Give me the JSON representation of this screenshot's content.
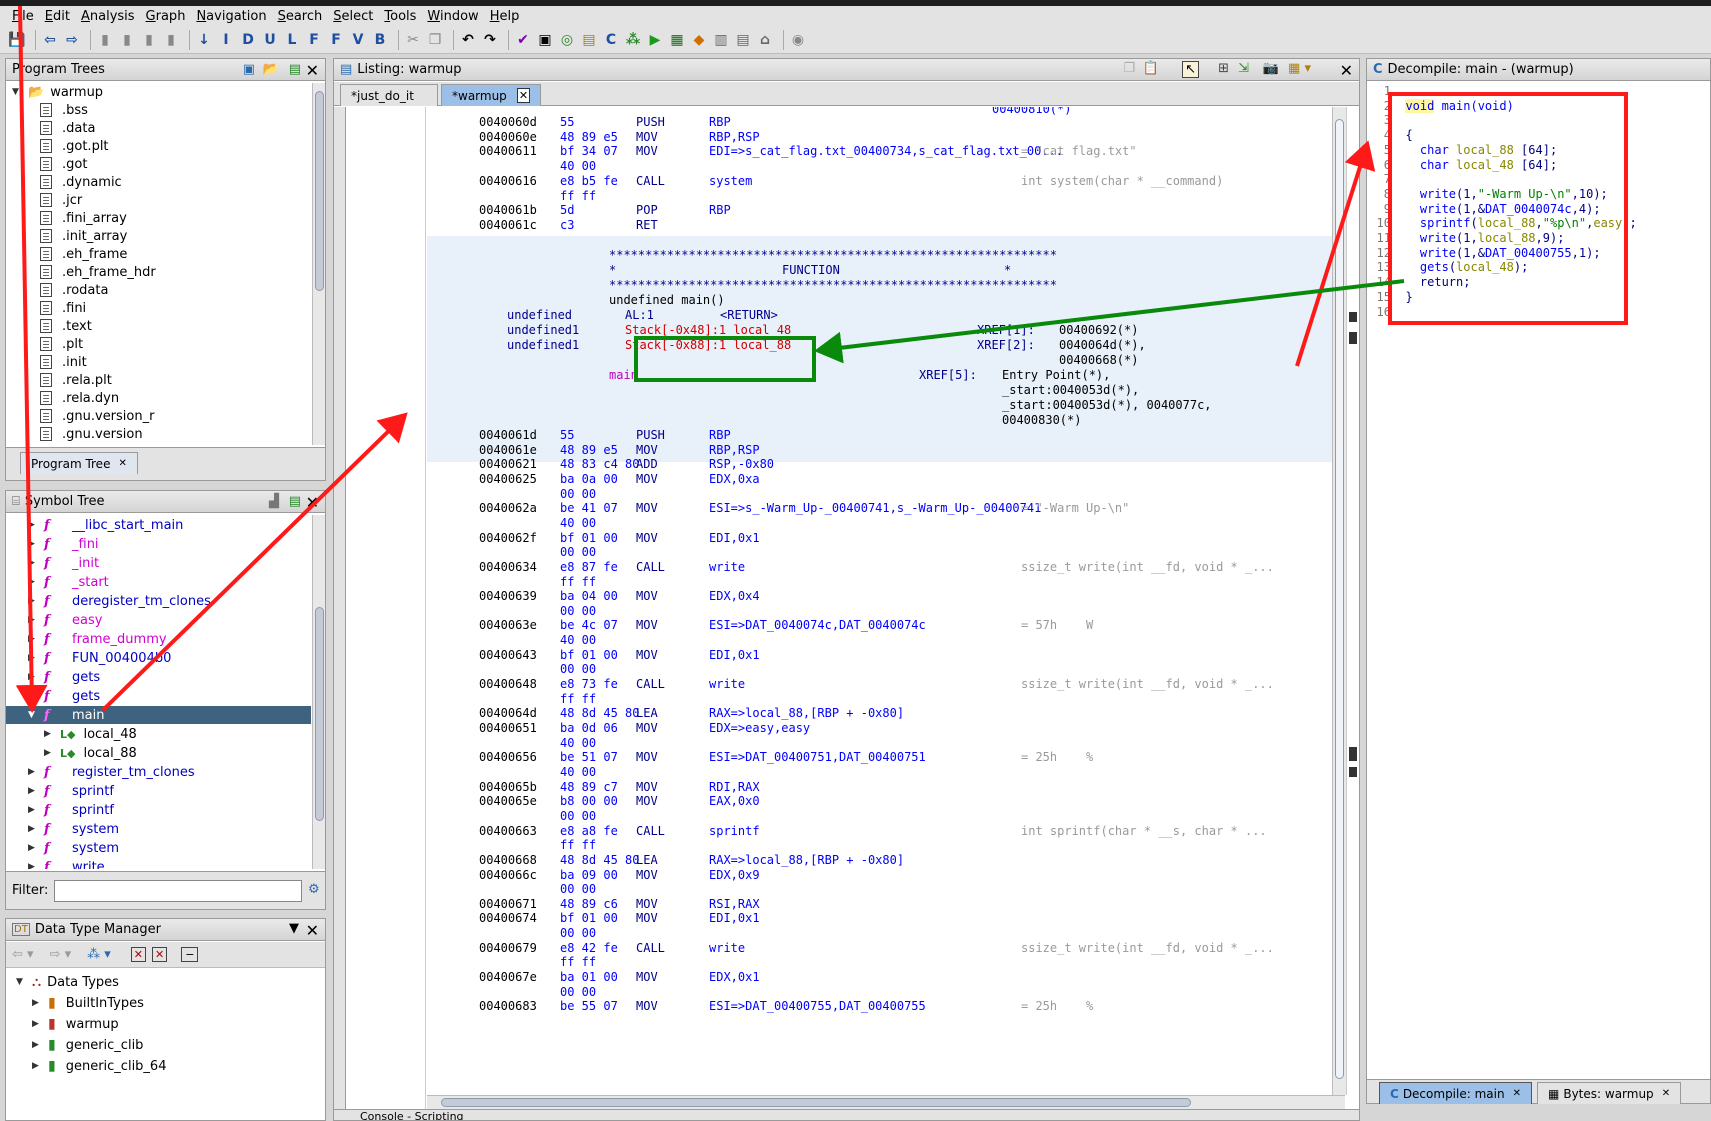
{
  "menu": [
    "File",
    "Edit",
    "Analysis",
    "Graph",
    "Navigation",
    "Search",
    "Select",
    "Tools",
    "Window",
    "Help"
  ],
  "program_trees": {
    "title": "Program Trees",
    "root": "warmup",
    "sections": [
      ".bss",
      ".data",
      ".got.plt",
      ".got",
      ".dynamic",
      ".jcr",
      ".fini_array",
      ".init_array",
      ".eh_frame",
      ".eh_frame_hdr",
      ".rodata",
      ".fini",
      ".text",
      ".plt",
      ".init",
      ".rela.plt",
      ".rela.dyn",
      ".gnu.version_r",
      ".gnu.version"
    ],
    "tab": "Program Tree"
  },
  "symbol_tree": {
    "title": "Symbol Tree",
    "items": [
      {
        "label": "__libc_start_main",
        "color": "blue"
      },
      {
        "label": "_fini",
        "color": "mag"
      },
      {
        "label": "_init",
        "color": "mag"
      },
      {
        "label": "_start",
        "color": "mag"
      },
      {
        "label": "deregister_tm_clones",
        "color": "blue"
      },
      {
        "label": "easy",
        "color": "mag"
      },
      {
        "label": "frame_dummy",
        "color": "mag"
      },
      {
        "label": "FUN_004004b0",
        "color": "blue"
      },
      {
        "label": "gets",
        "color": "blue"
      },
      {
        "label": "gets",
        "color": "blue"
      },
      {
        "label": "main",
        "color": "sel"
      },
      {
        "label": "local_48",
        "color": "child"
      },
      {
        "label": "local_88",
        "color": "child"
      },
      {
        "label": "register_tm_clones",
        "color": "blue"
      },
      {
        "label": "sprintf",
        "color": "blue"
      },
      {
        "label": "sprintf",
        "color": "blue"
      },
      {
        "label": "system",
        "color": "blue"
      },
      {
        "label": "system",
        "color": "blue"
      },
      {
        "label": "write",
        "color": "blue"
      }
    ],
    "filter_label": "Filter:",
    "filter_value": ""
  },
  "data_type_manager": {
    "title": "Data Type Manager",
    "root": "Data Types",
    "items": [
      "BuiltInTypes",
      "warmup",
      "generic_clib",
      "generic_clib_64"
    ]
  },
  "listing": {
    "title": "Listing:  warmup",
    "tabs": [
      "*just_do_it",
      "*warmup"
    ],
    "top_partial": "00400810(*)",
    "rows_pre": [
      {
        "a": "0040060d",
        "b": "55",
        "m": "PUSH",
        "o": "RBP",
        "c": ""
      },
      {
        "a": "0040060e",
        "b": "48 89 e5",
        "m": "MOV",
        "o": "RBP,RSP",
        "c": ""
      },
      {
        "a": "00400611",
        "b": "bf 34 07",
        "m": "MOV",
        "o": "EDI=>s_cat_flag.txt_00400734,s_cat_flag.txt_00...",
        "c": "= \"cat flag.txt\""
      },
      {
        "a": "",
        "b": "40 00",
        "m": "",
        "o": "",
        "c": ""
      },
      {
        "a": "00400616",
        "b": "e8 b5 fe",
        "m": "CALL",
        "o": "system",
        "c": "int system(char * __command)"
      },
      {
        "a": "",
        "b": "ff ff",
        "m": "",
        "o": "",
        "c": ""
      },
      {
        "a": "0040061b",
        "b": "5d",
        "m": "POP",
        "o": "RBP",
        "c": ""
      },
      {
        "a": "0040061c",
        "b": "c3",
        "m": "RET",
        "o": "",
        "c": ""
      }
    ],
    "func_header": {
      "stars": "**************************************************************",
      "label": "FUNCTION",
      "signature": "undefined main()",
      "ret_type": "undefined",
      "ret_reg": "AL:1",
      "ret_tag": "<RETURN>",
      "var1_type": "undefined1",
      "var1": "Stack[-0x48]:1 local_48",
      "var2_type": "undefined1",
      "var2": "Stack[-0x88]:1 local_88",
      "xref1_label": "XREF[1]:",
      "xref1": "00400692(*)",
      "xref2_label": "XREF[2]:",
      "xref2a": "0040064d(*),",
      "xref2b": "00400668(*)",
      "name": "main",
      "xref5_label": "XREF[5]:",
      "xref5": [
        "Entry Point(*),",
        "_start:0040053d(*),",
        "_start:0040053d(*), 0040077c,",
        "00400830(*)"
      ]
    },
    "rows_post": [
      {
        "a": "0040061d",
        "b": "55",
        "m": "PUSH",
        "o": "RBP",
        "c": ""
      },
      {
        "a": "0040061e",
        "b": "48 89 e5",
        "m": "MOV",
        "o": "RBP,RSP",
        "c": ""
      },
      {
        "a": "00400621",
        "b": "48 83 c4 80",
        "m": "ADD",
        "o": "RSP,-0x80",
        "c": ""
      },
      {
        "a": "00400625",
        "b": "ba 0a 00",
        "m": "MOV",
        "o": "EDX,0xa",
        "c": ""
      },
      {
        "a": "",
        "b": "00 00",
        "m": "",
        "o": "",
        "c": ""
      },
      {
        "a": "0040062a",
        "b": "be 41 07",
        "m": "MOV",
        "o": "ESI=>s_-Warm_Up-_00400741,s_-Warm_Up-_00400741",
        "c": "= \"-Warm Up-\\n\""
      },
      {
        "a": "",
        "b": "40 00",
        "m": "",
        "o": "",
        "c": ""
      },
      {
        "a": "0040062f",
        "b": "bf 01 00",
        "m": "MOV",
        "o": "EDI,0x1",
        "c": ""
      },
      {
        "a": "",
        "b": "00 00",
        "m": "",
        "o": "",
        "c": ""
      },
      {
        "a": "00400634",
        "b": "e8 87 fe",
        "m": "CALL",
        "o": "write",
        "c": "ssize_t write(int __fd, void * _..."
      },
      {
        "a": "",
        "b": "ff ff",
        "m": "",
        "o": "",
        "c": ""
      },
      {
        "a": "00400639",
        "b": "ba 04 00",
        "m": "MOV",
        "o": "EDX,0x4",
        "c": ""
      },
      {
        "a": "",
        "b": "00 00",
        "m": "",
        "o": "",
        "c": ""
      },
      {
        "a": "0040063e",
        "b": "be 4c 07",
        "m": "MOV",
        "o": "ESI=>DAT_0040074c,DAT_0040074c",
        "c": "= 57h    W"
      },
      {
        "a": "",
        "b": "40 00",
        "m": "",
        "o": "",
        "c": ""
      },
      {
        "a": "00400643",
        "b": "bf 01 00",
        "m": "MOV",
        "o": "EDI,0x1",
        "c": ""
      },
      {
        "a": "",
        "b": "00 00",
        "m": "",
        "o": "",
        "c": ""
      },
      {
        "a": "00400648",
        "b": "e8 73 fe",
        "m": "CALL",
        "o": "write",
        "c": "ssize_t write(int __fd, void * _..."
      },
      {
        "a": "",
        "b": "ff ff",
        "m": "",
        "o": "",
        "c": ""
      },
      {
        "a": "0040064d",
        "b": "48 8d 45 80",
        "m": "LEA",
        "o": "RAX=>local_88,[RBP + -0x80]",
        "c": ""
      },
      {
        "a": "00400651",
        "b": "ba 0d 06",
        "m": "MOV",
        "o": "EDX=>easy,easy",
        "c": ""
      },
      {
        "a": "",
        "b": "40 00",
        "m": "",
        "o": "",
        "c": ""
      },
      {
        "a": "00400656",
        "b": "be 51 07",
        "m": "MOV",
        "o": "ESI=>DAT_00400751,DAT_00400751",
        "c": "= 25h    %"
      },
      {
        "a": "",
        "b": "40 00",
        "m": "",
        "o": "",
        "c": ""
      },
      {
        "a": "0040065b",
        "b": "48 89 c7",
        "m": "MOV",
        "o": "RDI,RAX",
        "c": ""
      },
      {
        "a": "0040065e",
        "b": "b8 00 00",
        "m": "MOV",
        "o": "EAX,0x0",
        "c": ""
      },
      {
        "a": "",
        "b": "00 00",
        "m": "",
        "o": "",
        "c": ""
      },
      {
        "a": "00400663",
        "b": "e8 a8 fe",
        "m": "CALL",
        "o": "sprintf",
        "c": "int sprintf(char * __s, char * ..."
      },
      {
        "a": "",
        "b": "ff ff",
        "m": "",
        "o": "",
        "c": ""
      },
      {
        "a": "00400668",
        "b": "48 8d 45 80",
        "m": "LEA",
        "o": "RAX=>local_88,[RBP + -0x80]",
        "c": ""
      },
      {
        "a": "0040066c",
        "b": "ba 09 00",
        "m": "MOV",
        "o": "EDX,0x9",
        "c": ""
      },
      {
        "a": "",
        "b": "00 00",
        "m": "",
        "o": "",
        "c": ""
      },
      {
        "a": "00400671",
        "b": "48 89 c6",
        "m": "MOV",
        "o": "RSI,RAX",
        "c": ""
      },
      {
        "a": "00400674",
        "b": "bf 01 00",
        "m": "MOV",
        "o": "EDI,0x1",
        "c": ""
      },
      {
        "a": "",
        "b": "00 00",
        "m": "",
        "o": "",
        "c": ""
      },
      {
        "a": "00400679",
        "b": "e8 42 fe",
        "m": "CALL",
        "o": "write",
        "c": "ssize_t write(int __fd, void * _..."
      },
      {
        "a": "",
        "b": "ff ff",
        "m": "",
        "o": "",
        "c": ""
      },
      {
        "a": "0040067e",
        "b": "ba 01 00",
        "m": "MOV",
        "o": "EDX,0x1",
        "c": ""
      },
      {
        "a": "",
        "b": "00 00",
        "m": "",
        "o": "",
        "c": ""
      },
      {
        "a": "00400683",
        "b": "be 55 07",
        "m": "MOV",
        "o": "ESI=>DAT_00400755,DAT_00400755",
        "c": "= 25h    %"
      }
    ]
  },
  "decompile": {
    "title": "Decompile: main -  (warmup)",
    "line_numbers": [
      "1",
      "2",
      "3",
      "4",
      "5",
      "6",
      "7",
      "8",
      "9",
      "10",
      "11",
      "12",
      "13",
      "14",
      "15",
      "16"
    ],
    "lines": [
      [],
      [
        {
          "t": "void",
          "k": "ty"
        },
        {
          "t": " main(void)",
          "k": "fn"
        }
      ],
      [],
      [
        {
          "t": "{",
          "k": "kw"
        }
      ],
      [
        {
          "t": "  char ",
          "k": "ty"
        },
        {
          "t": "local_88",
          "k": "var"
        },
        {
          "t": " [64];",
          "k": "kw"
        }
      ],
      [
        {
          "t": "  char ",
          "k": "ty"
        },
        {
          "t": "local_48",
          "k": "var"
        },
        {
          "t": " [64];",
          "k": "kw"
        }
      ],
      [],
      [
        {
          "t": "  write",
          "k": "fn"
        },
        {
          "t": "(1,",
          "k": "kw"
        },
        {
          "t": "\"-Warm Up-\\n\"",
          "k": "str"
        },
        {
          "t": ",10);",
          "k": "kw"
        }
      ],
      [
        {
          "t": "  write",
          "k": "fn"
        },
        {
          "t": "(1,&",
          "k": "kw"
        },
        {
          "t": "DAT_0040074c",
          "k": "glob"
        },
        {
          "t": ",4);",
          "k": "kw"
        }
      ],
      [
        {
          "t": "  sprintf",
          "k": "fn"
        },
        {
          "t": "(",
          "k": "kw"
        },
        {
          "t": "local_88",
          "k": "var"
        },
        {
          "t": ",",
          "k": "kw"
        },
        {
          "t": "\"%p\\n\"",
          "k": "str"
        },
        {
          "t": ",",
          "k": "kw"
        },
        {
          "t": "easy",
          "k": "var"
        },
        {
          "t": ");",
          "k": "kw"
        }
      ],
      [
        {
          "t": "  write",
          "k": "fn"
        },
        {
          "t": "(1,",
          "k": "kw"
        },
        {
          "t": "local_88",
          "k": "var"
        },
        {
          "t": ",9);",
          "k": "kw"
        }
      ],
      [
        {
          "t": "  write",
          "k": "fn"
        },
        {
          "t": "(1,&",
          "k": "kw"
        },
        {
          "t": "DAT_00400755",
          "k": "glob"
        },
        {
          "t": ",1);",
          "k": "kw"
        }
      ],
      [
        {
          "t": "  gets",
          "k": "fn"
        },
        {
          "t": "(",
          "k": "kw"
        },
        {
          "t": "local_48",
          "k": "var"
        },
        {
          "t": ");",
          "k": "kw"
        }
      ],
      [
        {
          "t": "  return;",
          "k": "kw"
        }
      ],
      [
        {
          "t": "}",
          "k": "kw"
        }
      ],
      []
    ],
    "bottom_tabs": [
      "Decompile: main",
      "Bytes: warmup"
    ]
  },
  "annotation_colors": {
    "red": "#ff1a1a",
    "green": "#0a8a0a"
  },
  "bottom_strip": "Console - Scripting"
}
